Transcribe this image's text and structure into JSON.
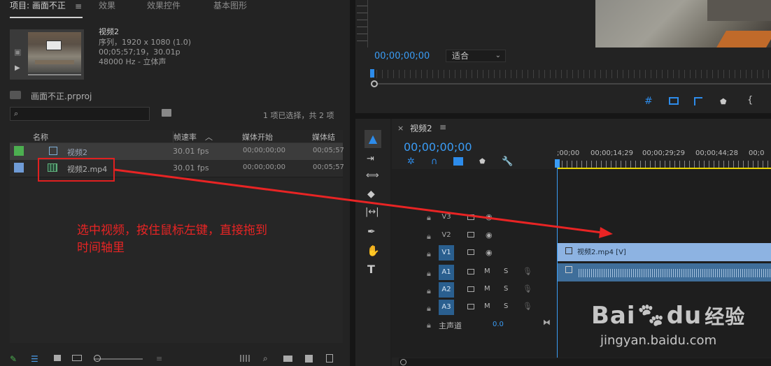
{
  "project_panel": {
    "tabs": [
      "项目: 画面不正",
      "效果",
      "效果控件",
      "基本图形"
    ],
    "menu_icon": "hamburger-icon",
    "clip_info": {
      "name": "视频2",
      "line1": "序列，1920 x 1080 (1.0)",
      "line2": "00;05;57;19，30.01p",
      "line3": "48000 Hz - 立体声"
    },
    "project_file": "画面不正.prproj",
    "search_placeholder": "",
    "selection_status": "1 项已选择，共 2 项",
    "columns": [
      "名称",
      "帧速率",
      "媒体开始",
      "媒体结"
    ],
    "rows": [
      {
        "name": "视频2",
        "fps": "30.01 fps",
        "start": "00;00;00;00",
        "end": "00;05;57",
        "color": "#4caf50"
      },
      {
        "name": "视频2.mp4",
        "fps": "30.01 fps",
        "start": "00;00;00;00",
        "end": "00;05;57",
        "color": "#6f9bd6"
      }
    ]
  },
  "annotation": {
    "line1": "选中视频，按住鼠标左键，直接拖到",
    "line2": "时间轴里"
  },
  "program_monitor": {
    "timecode": "00;00;00;00",
    "fit_label": "适合"
  },
  "timeline": {
    "sequence_name": "视频2",
    "timecode": "00;00;00;00",
    "ruler": [
      ";00;00",
      "00;00;14;29",
      "00;00;29;29",
      "00;00;44;28",
      "00;0"
    ],
    "video_tracks": [
      "V3",
      "V2",
      "V1"
    ],
    "audio_tracks": [
      "A1",
      "A2",
      "A3"
    ],
    "master_label": "主声道",
    "master_value": "0.0",
    "mute_label": "M",
    "solo_label": "S",
    "clip_label": "视频2.mp4 [V]"
  },
  "watermark": {
    "text1": "Bai",
    "text2": "du",
    "text3": "经验",
    "url": "jingyan.baidu.com"
  }
}
